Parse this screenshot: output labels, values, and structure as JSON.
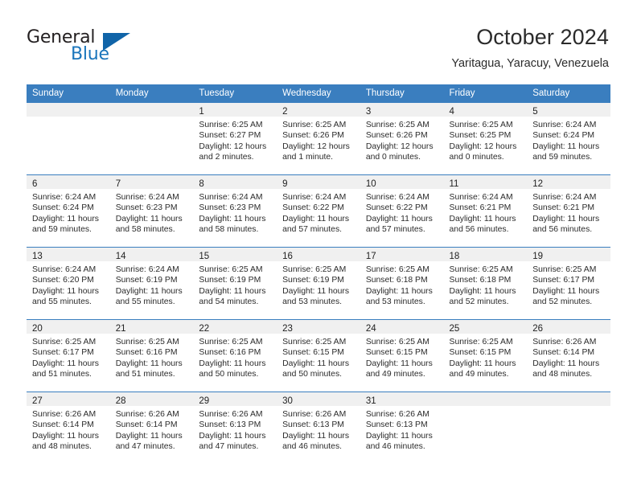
{
  "brand": {
    "name_top": "General",
    "name_bottom": "Blue",
    "triangle_icon": "triangle-icon",
    "color_dark": "#231f20",
    "color_blue": "#1b76bc"
  },
  "header": {
    "title": "October 2024",
    "subtitle": "Yaritagua, Yaracuy, Venezuela"
  },
  "theme": {
    "header_bg": "#3a7ebf",
    "daynum_bg": "#f0f0f0",
    "text": "#2b2b2b"
  },
  "calendar": {
    "weekday_headers": [
      "Sunday",
      "Monday",
      "Tuesday",
      "Wednesday",
      "Thursday",
      "Friday",
      "Saturday"
    ],
    "labels": {
      "sunrise": "Sunrise:",
      "sunset": "Sunset:",
      "daylight": "Daylight:"
    },
    "weeks": [
      [
        {
          "day": "",
          "sunrise": "",
          "sunset": "",
          "daylight": ""
        },
        {
          "day": "",
          "sunrise": "",
          "sunset": "",
          "daylight": ""
        },
        {
          "day": "1",
          "sunrise": "Sunrise: 6:25 AM",
          "sunset": "Sunset: 6:27 PM",
          "daylight": "Daylight: 12 hours and 2 minutes."
        },
        {
          "day": "2",
          "sunrise": "Sunrise: 6:25 AM",
          "sunset": "Sunset: 6:26 PM",
          "daylight": "Daylight: 12 hours and 1 minute."
        },
        {
          "day": "3",
          "sunrise": "Sunrise: 6:25 AM",
          "sunset": "Sunset: 6:26 PM",
          "daylight": "Daylight: 12 hours and 0 minutes."
        },
        {
          "day": "4",
          "sunrise": "Sunrise: 6:25 AM",
          "sunset": "Sunset: 6:25 PM",
          "daylight": "Daylight: 12 hours and 0 minutes."
        },
        {
          "day": "5",
          "sunrise": "Sunrise: 6:24 AM",
          "sunset": "Sunset: 6:24 PM",
          "daylight": "Daylight: 11 hours and 59 minutes."
        }
      ],
      [
        {
          "day": "6",
          "sunrise": "Sunrise: 6:24 AM",
          "sunset": "Sunset: 6:24 PM",
          "daylight": "Daylight: 11 hours and 59 minutes."
        },
        {
          "day": "7",
          "sunrise": "Sunrise: 6:24 AM",
          "sunset": "Sunset: 6:23 PM",
          "daylight": "Daylight: 11 hours and 58 minutes."
        },
        {
          "day": "8",
          "sunrise": "Sunrise: 6:24 AM",
          "sunset": "Sunset: 6:23 PM",
          "daylight": "Daylight: 11 hours and 58 minutes."
        },
        {
          "day": "9",
          "sunrise": "Sunrise: 6:24 AM",
          "sunset": "Sunset: 6:22 PM",
          "daylight": "Daylight: 11 hours and 57 minutes."
        },
        {
          "day": "10",
          "sunrise": "Sunrise: 6:24 AM",
          "sunset": "Sunset: 6:22 PM",
          "daylight": "Daylight: 11 hours and 57 minutes."
        },
        {
          "day": "11",
          "sunrise": "Sunrise: 6:24 AM",
          "sunset": "Sunset: 6:21 PM",
          "daylight": "Daylight: 11 hours and 56 minutes."
        },
        {
          "day": "12",
          "sunrise": "Sunrise: 6:24 AM",
          "sunset": "Sunset: 6:21 PM",
          "daylight": "Daylight: 11 hours and 56 minutes."
        }
      ],
      [
        {
          "day": "13",
          "sunrise": "Sunrise: 6:24 AM",
          "sunset": "Sunset: 6:20 PM",
          "daylight": "Daylight: 11 hours and 55 minutes."
        },
        {
          "day": "14",
          "sunrise": "Sunrise: 6:24 AM",
          "sunset": "Sunset: 6:19 PM",
          "daylight": "Daylight: 11 hours and 55 minutes."
        },
        {
          "day": "15",
          "sunrise": "Sunrise: 6:25 AM",
          "sunset": "Sunset: 6:19 PM",
          "daylight": "Daylight: 11 hours and 54 minutes."
        },
        {
          "day": "16",
          "sunrise": "Sunrise: 6:25 AM",
          "sunset": "Sunset: 6:19 PM",
          "daylight": "Daylight: 11 hours and 53 minutes."
        },
        {
          "day": "17",
          "sunrise": "Sunrise: 6:25 AM",
          "sunset": "Sunset: 6:18 PM",
          "daylight": "Daylight: 11 hours and 53 minutes."
        },
        {
          "day": "18",
          "sunrise": "Sunrise: 6:25 AM",
          "sunset": "Sunset: 6:18 PM",
          "daylight": "Daylight: 11 hours and 52 minutes."
        },
        {
          "day": "19",
          "sunrise": "Sunrise: 6:25 AM",
          "sunset": "Sunset: 6:17 PM",
          "daylight": "Daylight: 11 hours and 52 minutes."
        }
      ],
      [
        {
          "day": "20",
          "sunrise": "Sunrise: 6:25 AM",
          "sunset": "Sunset: 6:17 PM",
          "daylight": "Daylight: 11 hours and 51 minutes."
        },
        {
          "day": "21",
          "sunrise": "Sunrise: 6:25 AM",
          "sunset": "Sunset: 6:16 PM",
          "daylight": "Daylight: 11 hours and 51 minutes."
        },
        {
          "day": "22",
          "sunrise": "Sunrise: 6:25 AM",
          "sunset": "Sunset: 6:16 PM",
          "daylight": "Daylight: 11 hours and 50 minutes."
        },
        {
          "day": "23",
          "sunrise": "Sunrise: 6:25 AM",
          "sunset": "Sunset: 6:15 PM",
          "daylight": "Daylight: 11 hours and 50 minutes."
        },
        {
          "day": "24",
          "sunrise": "Sunrise: 6:25 AM",
          "sunset": "Sunset: 6:15 PM",
          "daylight": "Daylight: 11 hours and 49 minutes."
        },
        {
          "day": "25",
          "sunrise": "Sunrise: 6:25 AM",
          "sunset": "Sunset: 6:15 PM",
          "daylight": "Daylight: 11 hours and 49 minutes."
        },
        {
          "day": "26",
          "sunrise": "Sunrise: 6:26 AM",
          "sunset": "Sunset: 6:14 PM",
          "daylight": "Daylight: 11 hours and 48 minutes."
        }
      ],
      [
        {
          "day": "27",
          "sunrise": "Sunrise: 6:26 AM",
          "sunset": "Sunset: 6:14 PM",
          "daylight": "Daylight: 11 hours and 48 minutes."
        },
        {
          "day": "28",
          "sunrise": "Sunrise: 6:26 AM",
          "sunset": "Sunset: 6:14 PM",
          "daylight": "Daylight: 11 hours and 47 minutes."
        },
        {
          "day": "29",
          "sunrise": "Sunrise: 6:26 AM",
          "sunset": "Sunset: 6:13 PM",
          "daylight": "Daylight: 11 hours and 47 minutes."
        },
        {
          "day": "30",
          "sunrise": "Sunrise: 6:26 AM",
          "sunset": "Sunset: 6:13 PM",
          "daylight": "Daylight: 11 hours and 46 minutes."
        },
        {
          "day": "31",
          "sunrise": "Sunrise: 6:26 AM",
          "sunset": "Sunset: 6:13 PM",
          "daylight": "Daylight: 11 hours and 46 minutes."
        },
        {
          "day": "",
          "sunrise": "",
          "sunset": "",
          "daylight": ""
        },
        {
          "day": "",
          "sunrise": "",
          "sunset": "",
          "daylight": ""
        }
      ]
    ]
  }
}
